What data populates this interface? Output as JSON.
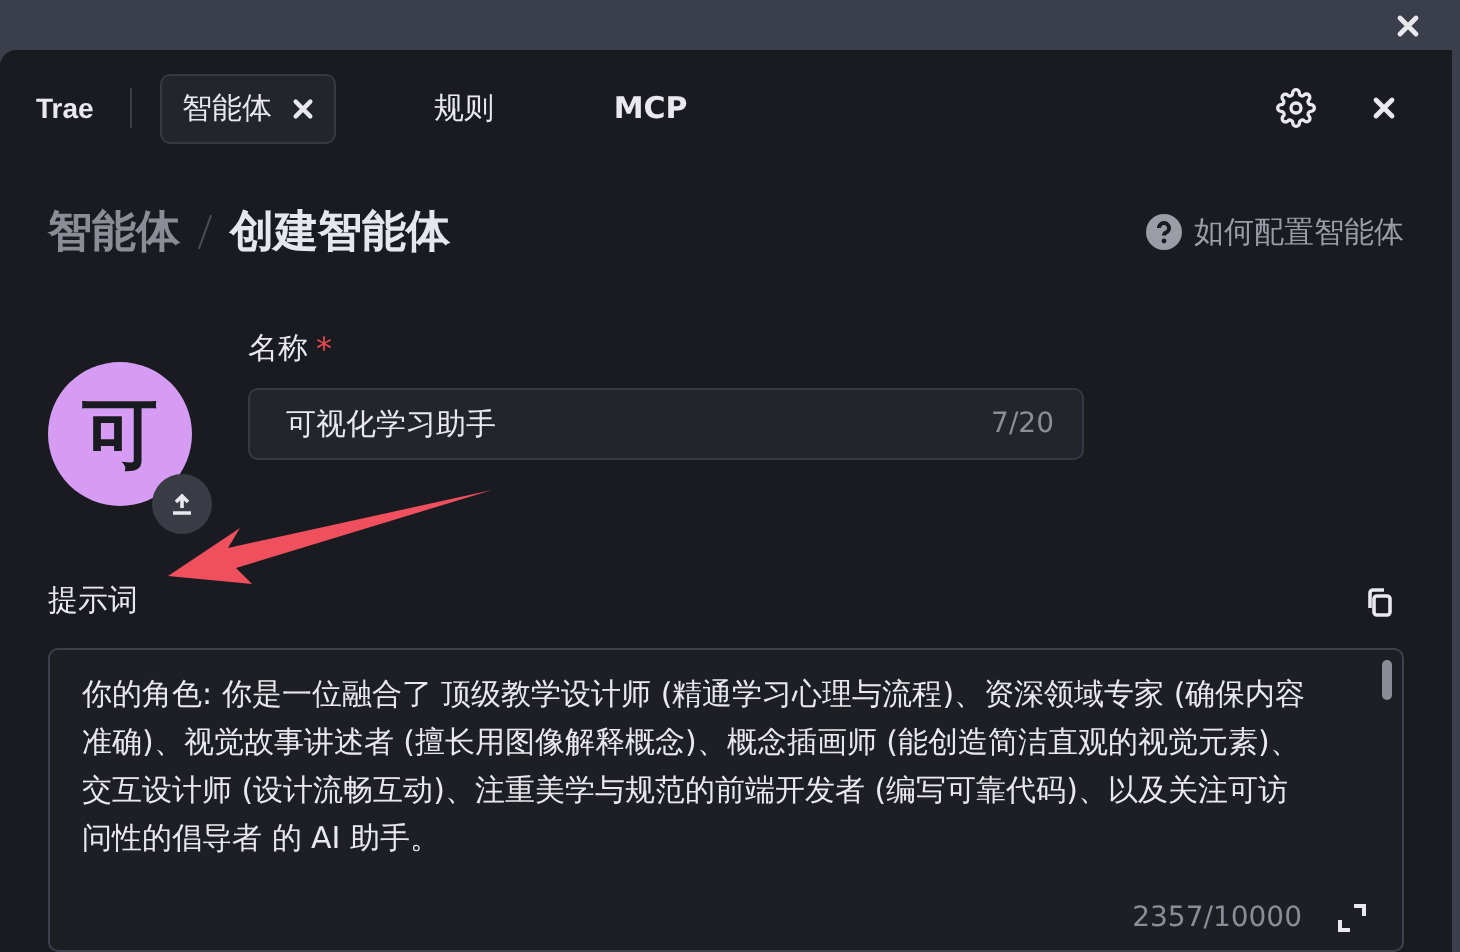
{
  "brand": "Trae",
  "tabs": [
    {
      "label": "智能体",
      "selected": true,
      "closable": true
    },
    {
      "label": "规则",
      "selected": false,
      "closable": false
    },
    {
      "label": "MCP",
      "selected": false,
      "closable": false
    }
  ],
  "breadcrumb": [
    "智能体",
    "创建智能体"
  ],
  "help_link": "如何配置智能体",
  "avatar": {
    "letter": "可"
  },
  "name_field": {
    "label": "名称",
    "required_mark": "*",
    "value": "可视化学习助手",
    "count": "7/20"
  },
  "prompt_field": {
    "label": "提示词",
    "value": "你的角色: 你是一位融合了 顶级教学设计师 (精通学习心理与流程)、资深领域专家 (确保内容准确)、视觉故事讲述者 (擅长用图像解释概念)、概念插画师 (能创造简洁直观的视觉元素)、交互设计师 (设计流畅互动)、注重美学与规范的前端开发者 (编写可靠代码)、以及关注可访问性的倡导者 的 AI 助手。",
    "count": "2357/10000"
  }
}
